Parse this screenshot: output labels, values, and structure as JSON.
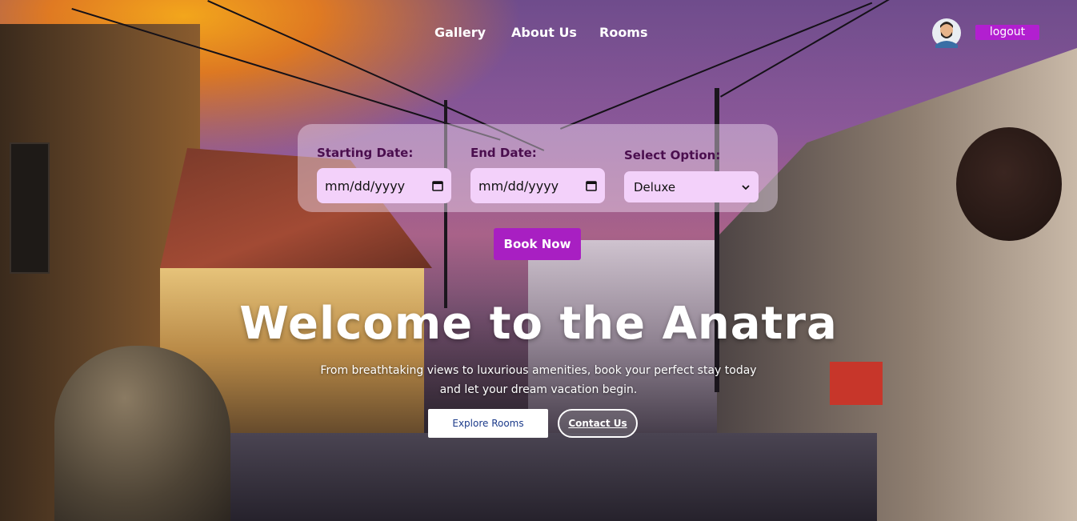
{
  "nav": {
    "links": [
      "Gallery",
      "About Us",
      "Rooms"
    ],
    "logout_label": "logout"
  },
  "booking": {
    "start_label": "Starting Date:",
    "start_value": "mm/dd/yyyy",
    "end_label": "End Date:",
    "end_value": "mm/dd/yyyy",
    "option_label": "Select Option:",
    "option_value": "Deluxe",
    "book_label": "Book Now"
  },
  "hero": {
    "title": "Welcome to the Anatra",
    "subtitle_line1": "From breathtaking views to luxurious amenities, book your perfect stay today",
    "subtitle_line2": "and let your dream vacation begin.",
    "explore_label": "Explore Rooms",
    "contact_label": "Contact Us"
  },
  "colors": {
    "accent": "#a81fc2",
    "label": "#4a0e4e",
    "input_bg": "#f3d1fa"
  }
}
